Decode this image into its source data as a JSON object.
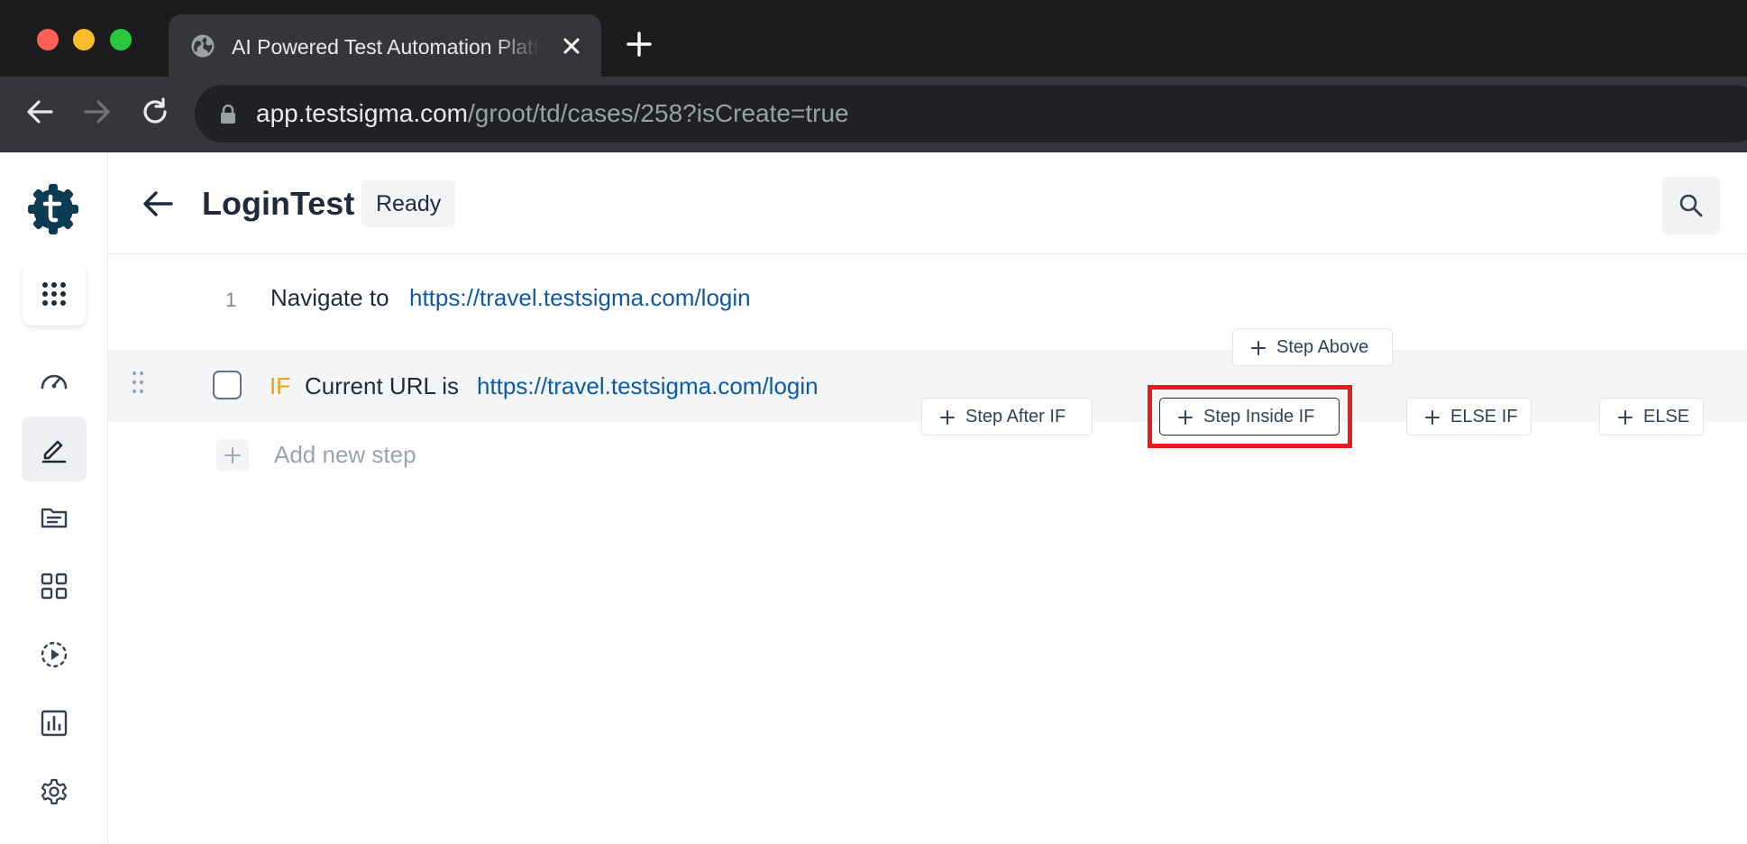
{
  "browser": {
    "tab_title": "AI Powered Test Automation Platform",
    "tab_icon": "globe-icon",
    "url_host": "app.testsigma.com",
    "url_path": "/groot/td/cases/258?isCreate=true"
  },
  "sidebar": {
    "logo": "testsigma-logo",
    "items": [
      {
        "name": "apps-grid-icon"
      },
      {
        "name": "dashboard-icon"
      },
      {
        "name": "test-development-icon",
        "active": true
      },
      {
        "name": "test-data-icon"
      },
      {
        "name": "elements-icon"
      },
      {
        "name": "runs-icon"
      },
      {
        "name": "reports-icon"
      },
      {
        "name": "settings-icon"
      }
    ]
  },
  "header": {
    "title": "LoginTest",
    "status": "Ready"
  },
  "steps": [
    {
      "number": "1",
      "text": "Navigate to",
      "link": "https://travel.testsigma.com/login"
    },
    {
      "keyword": "IF",
      "text": "Current URL is",
      "link": "https://travel.testsigma.com/login"
    }
  ],
  "add_step": {
    "label": "Add new step"
  },
  "actions": {
    "step_above": "Step Above",
    "step_after_if": "Step After IF",
    "step_inside_if": "Step Inside IF",
    "else_if": "ELSE IF",
    "else": "ELSE"
  },
  "colors": {
    "brand": "#0d3b53",
    "link": "#0e5aa7",
    "if_keyword": "#f59e0b",
    "highlight": "#e41e1e"
  }
}
